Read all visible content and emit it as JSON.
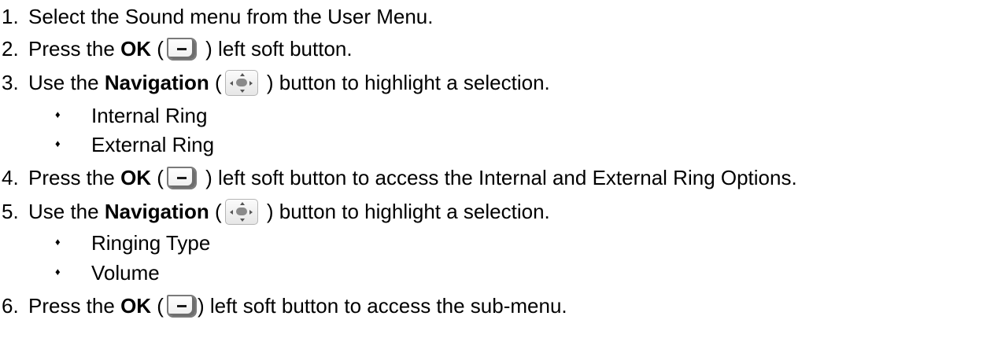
{
  "steps": [
    {
      "num": "1.",
      "text": "Select the Sound menu from the User Menu."
    },
    {
      "num": "2.",
      "pre": "Press the ",
      "bold": "OK",
      "open": " (",
      "close": " ) left soft button."
    },
    {
      "num": "3.",
      "pre": "Use the ",
      "bold": "Navigation",
      "open": " (",
      "close": " ) button to highlight a selection."
    },
    {
      "num": "4.",
      "pre": "Press the ",
      "bold": "OK",
      "open": " (",
      "close": " ) left soft button to access the Internal and External Ring Options."
    },
    {
      "num": "5.",
      "pre": "Use the ",
      "bold": "Navigation",
      "open": " (",
      "close": " ) button to highlight a selection."
    },
    {
      "num": "6.",
      "pre": "Press the ",
      "bold": "OK",
      "open": " (",
      "close": ") left soft button to access the sub-menu."
    }
  ],
  "sub_items": {
    "step3": [
      "Internal Ring",
      "External Ring"
    ],
    "step5": [
      "Ringing Type",
      "Volume"
    ]
  },
  "bullet_glyph": "♦",
  "icons": {
    "ok_button": "left-soft-button-icon",
    "navigation_button": "navigation-button-icon"
  }
}
